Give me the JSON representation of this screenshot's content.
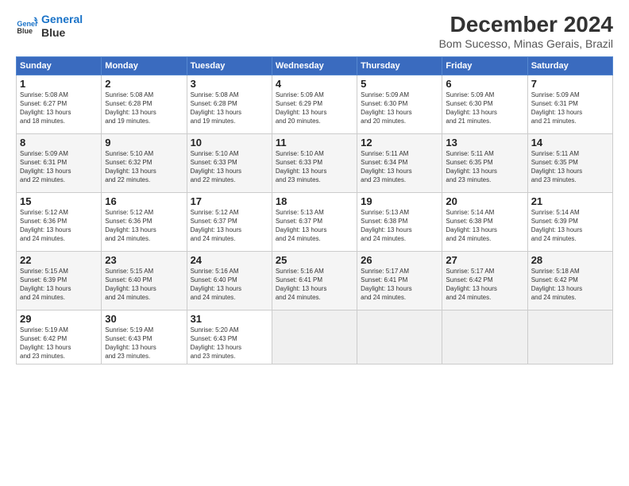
{
  "logo": {
    "line1": "General",
    "line2": "Blue"
  },
  "title": "December 2024",
  "subtitle": "Bom Sucesso, Minas Gerais, Brazil",
  "days_of_week": [
    "Sunday",
    "Monday",
    "Tuesday",
    "Wednesday",
    "Thursday",
    "Friday",
    "Saturday"
  ],
  "weeks": [
    [
      {
        "num": "1",
        "rise": "5:08 AM",
        "set": "6:27 PM",
        "daylight": "13 hours and 18 minutes."
      },
      {
        "num": "2",
        "rise": "5:08 AM",
        "set": "6:28 PM",
        "daylight": "13 hours and 19 minutes."
      },
      {
        "num": "3",
        "rise": "5:08 AM",
        "set": "6:28 PM",
        "daylight": "13 hours and 19 minutes."
      },
      {
        "num": "4",
        "rise": "5:09 AM",
        "set": "6:29 PM",
        "daylight": "13 hours and 20 minutes."
      },
      {
        "num": "5",
        "rise": "5:09 AM",
        "set": "6:30 PM",
        "daylight": "13 hours and 20 minutes."
      },
      {
        "num": "6",
        "rise": "5:09 AM",
        "set": "6:30 PM",
        "daylight": "13 hours and 21 minutes."
      },
      {
        "num": "7",
        "rise": "5:09 AM",
        "set": "6:31 PM",
        "daylight": "13 hours and 21 minutes."
      }
    ],
    [
      {
        "num": "8",
        "rise": "5:09 AM",
        "set": "6:31 PM",
        "daylight": "13 hours and 22 minutes."
      },
      {
        "num": "9",
        "rise": "5:10 AM",
        "set": "6:32 PM",
        "daylight": "13 hours and 22 minutes."
      },
      {
        "num": "10",
        "rise": "5:10 AM",
        "set": "6:33 PM",
        "daylight": "13 hours and 22 minutes."
      },
      {
        "num": "11",
        "rise": "5:10 AM",
        "set": "6:33 PM",
        "daylight": "13 hours and 23 minutes."
      },
      {
        "num": "12",
        "rise": "5:11 AM",
        "set": "6:34 PM",
        "daylight": "13 hours and 23 minutes."
      },
      {
        "num": "13",
        "rise": "5:11 AM",
        "set": "6:35 PM",
        "daylight": "13 hours and 23 minutes."
      },
      {
        "num": "14",
        "rise": "5:11 AM",
        "set": "6:35 PM",
        "daylight": "13 hours and 23 minutes."
      }
    ],
    [
      {
        "num": "15",
        "rise": "5:12 AM",
        "set": "6:36 PM",
        "daylight": "13 hours and 24 minutes."
      },
      {
        "num": "16",
        "rise": "5:12 AM",
        "set": "6:36 PM",
        "daylight": "13 hours and 24 minutes."
      },
      {
        "num": "17",
        "rise": "5:12 AM",
        "set": "6:37 PM",
        "daylight": "13 hours and 24 minutes."
      },
      {
        "num": "18",
        "rise": "5:13 AM",
        "set": "6:37 PM",
        "daylight": "13 hours and 24 minutes."
      },
      {
        "num": "19",
        "rise": "5:13 AM",
        "set": "6:38 PM",
        "daylight": "13 hours and 24 minutes."
      },
      {
        "num": "20",
        "rise": "5:14 AM",
        "set": "6:38 PM",
        "daylight": "13 hours and 24 minutes."
      },
      {
        "num": "21",
        "rise": "5:14 AM",
        "set": "6:39 PM",
        "daylight": "13 hours and 24 minutes."
      }
    ],
    [
      {
        "num": "22",
        "rise": "5:15 AM",
        "set": "6:39 PM",
        "daylight": "13 hours and 24 minutes."
      },
      {
        "num": "23",
        "rise": "5:15 AM",
        "set": "6:40 PM",
        "daylight": "13 hours and 24 minutes."
      },
      {
        "num": "24",
        "rise": "5:16 AM",
        "set": "6:40 PM",
        "daylight": "13 hours and 24 minutes."
      },
      {
        "num": "25",
        "rise": "5:16 AM",
        "set": "6:41 PM",
        "daylight": "13 hours and 24 minutes."
      },
      {
        "num": "26",
        "rise": "5:17 AM",
        "set": "6:41 PM",
        "daylight": "13 hours and 24 minutes."
      },
      {
        "num": "27",
        "rise": "5:17 AM",
        "set": "6:42 PM",
        "daylight": "13 hours and 24 minutes."
      },
      {
        "num": "28",
        "rise": "5:18 AM",
        "set": "6:42 PM",
        "daylight": "13 hours and 24 minutes."
      }
    ],
    [
      {
        "num": "29",
        "rise": "5:19 AM",
        "set": "6:42 PM",
        "daylight": "13 hours and 23 minutes."
      },
      {
        "num": "30",
        "rise": "5:19 AM",
        "set": "6:43 PM",
        "daylight": "13 hours and 23 minutes."
      },
      {
        "num": "31",
        "rise": "5:20 AM",
        "set": "6:43 PM",
        "daylight": "13 hours and 23 minutes."
      },
      null,
      null,
      null,
      null
    ]
  ]
}
